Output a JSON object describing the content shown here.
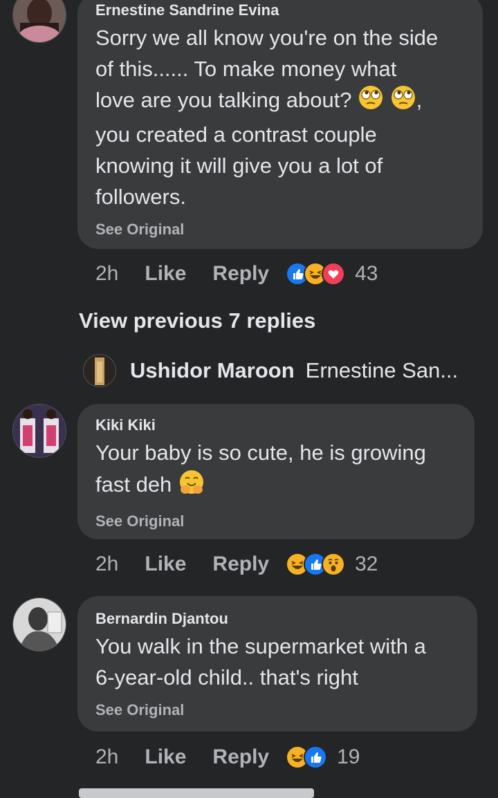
{
  "comments": [
    {
      "author": "Ernestine Sandrine Evina",
      "lines": [
        "Sorry we all know you're on the side",
        "of this...... To make money what",
        "love are you talking about?",
        "you created a contrast couple",
        "knowing it will give you a lot of",
        "followers."
      ],
      "line3_suffix": ",",
      "see_original": "See Original",
      "time": "2h",
      "like": "Like",
      "reply": "Reply",
      "reactions": [
        "like",
        "haha",
        "love"
      ],
      "count": "43"
    },
    {
      "author": "Kiki Kiki",
      "lines": [
        "Your baby is so cute, he is growing",
        "fast deh"
      ],
      "see_original": "See Original",
      "time": "2h",
      "like": "Like",
      "reply": "Reply",
      "reactions": [
        "haha",
        "like",
        "wow"
      ],
      "count": "32"
    },
    {
      "author": "Bernardin Djantou",
      "lines": [
        "You walk in the supermarket with a",
        "6-year-old child.. that's right"
      ],
      "see_original": "See Original",
      "time": "2h",
      "like": "Like",
      "reply": "Reply",
      "reactions": [
        "haha",
        "like"
      ],
      "count": "19"
    }
  ],
  "view_previous": "View previous 7 replies",
  "reply_preview": {
    "name": "Ushidor Maroon",
    "snippet": "Ernestine San..."
  },
  "colors": {
    "background": "#242526",
    "bubble": "#3a3b3c",
    "text": "#e4e6eb",
    "muted": "#b0b3b8",
    "like_blue": "#1877f2",
    "love_red": "#f33e58",
    "haha_yellow": "#f7b125"
  },
  "icons": {
    "reaction_like": "like-icon",
    "reaction_haha": "haha-icon",
    "reaction_love": "love-icon",
    "reaction_wow": "wow-icon",
    "emoji_eyeroll": "eye-roll-emoji-icon",
    "emoji_smiling_hands": "hugging-face-emoji-icon"
  }
}
